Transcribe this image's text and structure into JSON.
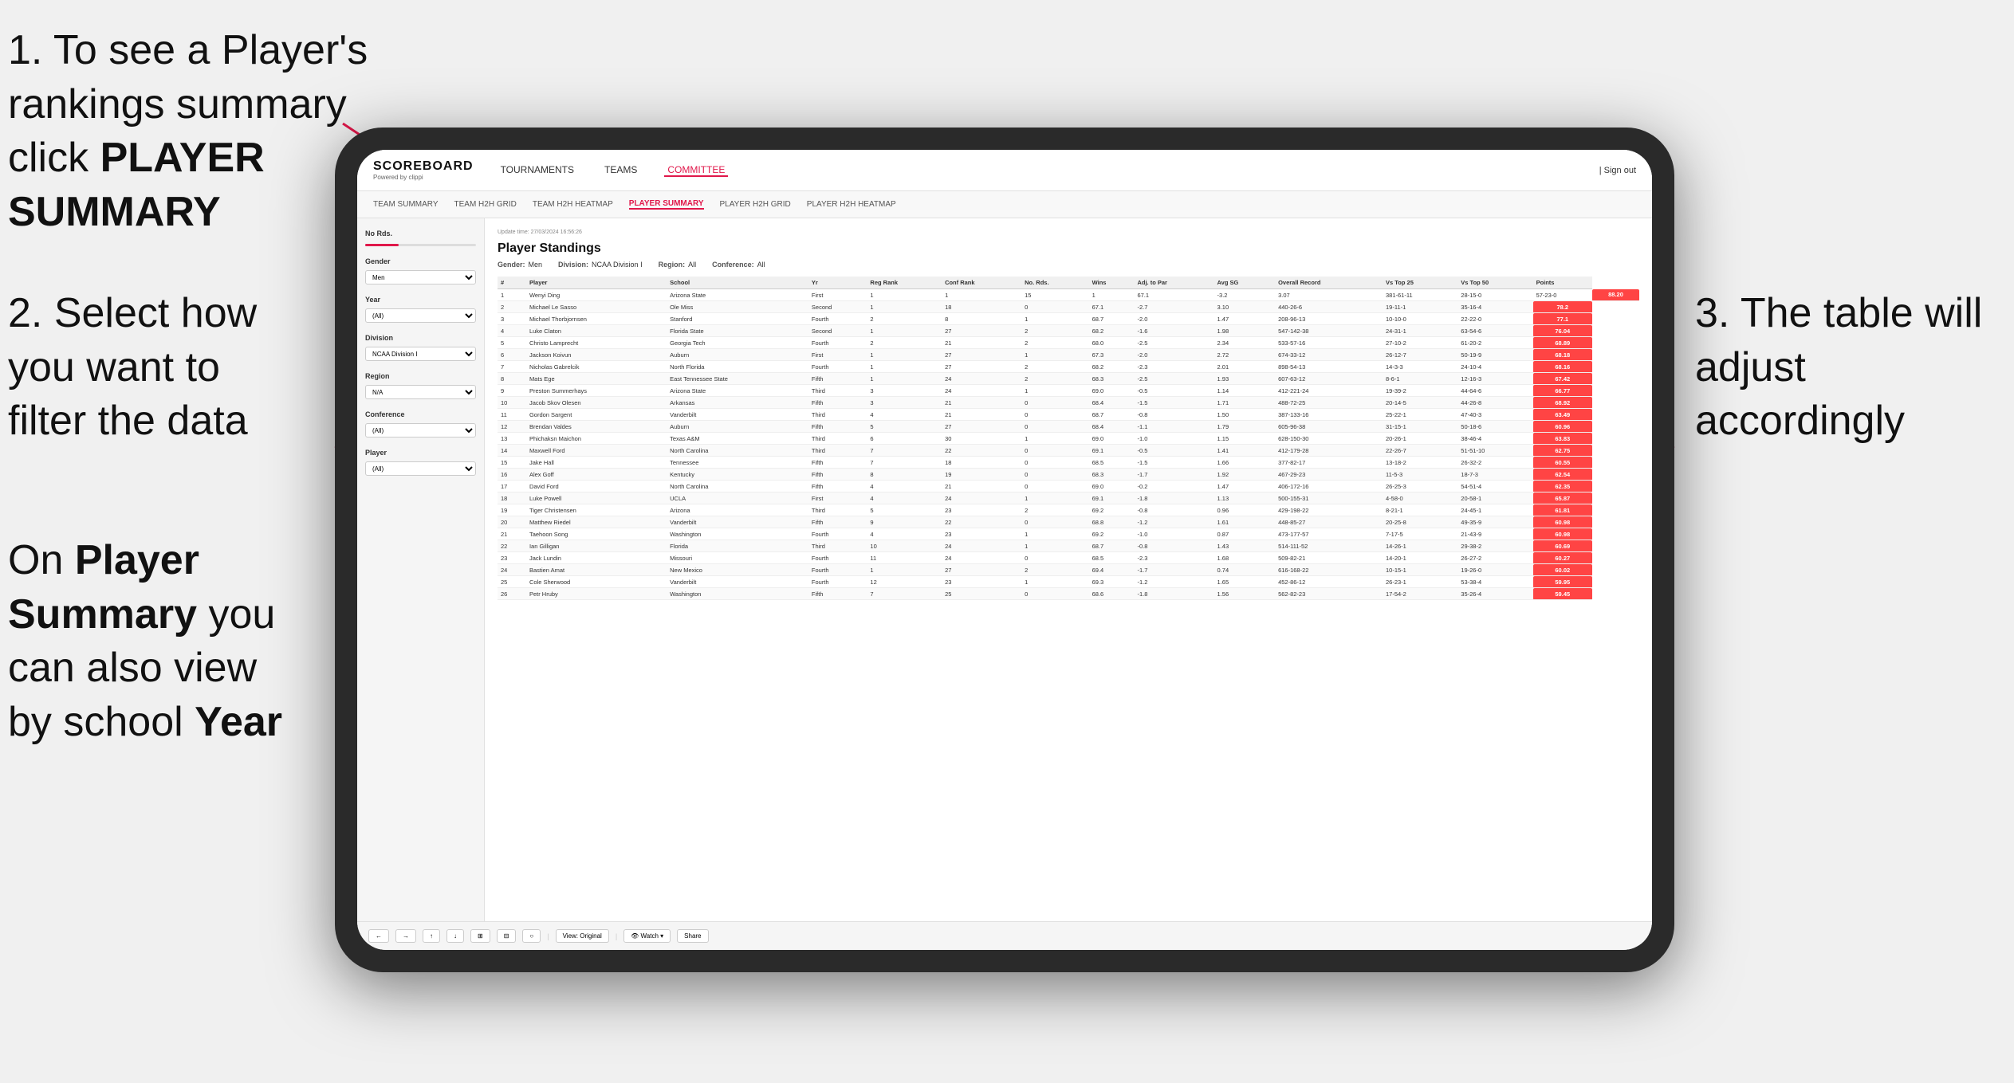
{
  "instructions": {
    "step1": "1. To see a Player's rankings summary click ",
    "step1_bold": "PLAYER SUMMARY",
    "step2_title": "2. Select how you want to filter the data",
    "step3_title": "3. The table will adjust accordingly",
    "bottom_note": "On ",
    "bottom_bold1": "Player Summary",
    "bottom_note2": " you can also view by school ",
    "bottom_bold2": "Year"
  },
  "navbar": {
    "logo": "SCOREBOARD",
    "logo_sub": "Powered by clippi",
    "links": [
      "TOURNAMENTS",
      "TEAMS",
      "COMMITTEE"
    ],
    "active_link": "COMMITTEE",
    "right_items": [
      "| Sign out"
    ]
  },
  "sub_navbar": {
    "links": [
      "TEAM SUMMARY",
      "TEAM H2H GRID",
      "TEAM H2H HEATMAP",
      "PLAYER SUMMARY",
      "PLAYER H2H GRID",
      "PLAYER H2H HEATMAP"
    ],
    "active": "PLAYER SUMMARY"
  },
  "sidebar": {
    "no_rds_label": "No Rds.",
    "gender_label": "Gender",
    "gender_value": "Men",
    "year_label": "Year",
    "year_value": "(All)",
    "division_label": "Division",
    "division_value": "NCAA Division I",
    "region_label": "Region",
    "region_value": "N/A",
    "conference_label": "Conference",
    "conference_value": "(All)",
    "player_label": "Player",
    "player_value": "(All)"
  },
  "table": {
    "title": "Player Standings",
    "update_time": "Update time: 27/03/2024 16:56:26",
    "filters": {
      "gender_label": "Gender:",
      "gender_value": "Men",
      "division_label": "Division:",
      "division_value": "NCAA Division I",
      "region_label": "Region:",
      "region_value": "All",
      "conference_label": "Conference:",
      "conference_value": "All"
    },
    "columns": [
      "#",
      "Player",
      "School",
      "Yr",
      "Reg Rank",
      "Conf Rank",
      "No. Rds.",
      "Wins",
      "Adj. to Par",
      "Avg SG",
      "Overall Record",
      "Vs Top 25",
      "Vs Top 50",
      "Points"
    ],
    "rows": [
      [
        "1",
        "Wenyi Ding",
        "Arizona State",
        "First",
        "1",
        "1",
        "15",
        "1",
        "67.1",
        "-3.2",
        "3.07",
        "381-61-11",
        "28-15-0",
        "57-23-0",
        "88.20"
      ],
      [
        "2",
        "Michael Le Sasso",
        "Ole Miss",
        "Second",
        "1",
        "18",
        "0",
        "67.1",
        "-2.7",
        "3.10",
        "440-26-6",
        "19-11-1",
        "35-16-4",
        "78.2"
      ],
      [
        "3",
        "Michael Thorbjornsen",
        "Stanford",
        "Fourth",
        "2",
        "8",
        "1",
        "68.7",
        "-2.0",
        "1.47",
        "208-96-13",
        "10-10-0",
        "22-22-0",
        "77.1"
      ],
      [
        "4",
        "Luke Claton",
        "Florida State",
        "Second",
        "1",
        "27",
        "2",
        "68.2",
        "-1.6",
        "1.98",
        "547-142-38",
        "24-31-1",
        "63-54-6",
        "76.04"
      ],
      [
        "5",
        "Christo Lamprecht",
        "Georgia Tech",
        "Fourth",
        "2",
        "21",
        "2",
        "68.0",
        "-2.5",
        "2.34",
        "533-57-16",
        "27-10-2",
        "61-20-2",
        "68.89"
      ],
      [
        "6",
        "Jackson Koivun",
        "Auburn",
        "First",
        "1",
        "27",
        "1",
        "67.3",
        "-2.0",
        "2.72",
        "674-33-12",
        "26-12-7",
        "50-19-9",
        "68.18"
      ],
      [
        "7",
        "Nicholas Gabrelcik",
        "North Florida",
        "Fourth",
        "1",
        "27",
        "2",
        "68.2",
        "-2.3",
        "2.01",
        "898-54-13",
        "14-3-3",
        "24-10-4",
        "68.16"
      ],
      [
        "8",
        "Mats Ege",
        "East Tennessee State",
        "Fifth",
        "1",
        "24",
        "2",
        "68.3",
        "-2.5",
        "1.93",
        "607-63-12",
        "8-6-1",
        "12-16-3",
        "67.42"
      ],
      [
        "9",
        "Preston Summerhays",
        "Arizona State",
        "Third",
        "3",
        "24",
        "1",
        "69.0",
        "-0.5",
        "1.14",
        "412-221-24",
        "19-39-2",
        "44-64-6",
        "66.77"
      ],
      [
        "10",
        "Jacob Skov Olesen",
        "Arkansas",
        "Fifth",
        "3",
        "21",
        "0",
        "68.4",
        "-1.5",
        "1.71",
        "488-72-25",
        "20-14-5",
        "44-26-8",
        "68.92"
      ],
      [
        "11",
        "Gordon Sargent",
        "Vanderbilt",
        "Third",
        "4",
        "21",
        "0",
        "68.7",
        "-0.8",
        "1.50",
        "387-133-16",
        "25-22-1",
        "47-40-3",
        "63.49"
      ],
      [
        "12",
        "Brendan Valdes",
        "Auburn",
        "Fifth",
        "5",
        "27",
        "0",
        "68.4",
        "-1.1",
        "1.79",
        "605-96-38",
        "31-15-1",
        "50-18-6",
        "60.96"
      ],
      [
        "13",
        "Phichaksn Maichon",
        "Texas A&M",
        "Third",
        "6",
        "30",
        "1",
        "69.0",
        "-1.0",
        "1.15",
        "628-150-30",
        "20-26-1",
        "38-46-4",
        "63.83"
      ],
      [
        "14",
        "Maxwell Ford",
        "North Carolina",
        "Third",
        "7",
        "22",
        "0",
        "69.1",
        "-0.5",
        "1.41",
        "412-179-28",
        "22-26-7",
        "51-51-10",
        "62.75"
      ],
      [
        "15",
        "Jake Hall",
        "Tennessee",
        "Fifth",
        "7",
        "18",
        "0",
        "68.5",
        "-1.5",
        "1.66",
        "377-82-17",
        "13-18-2",
        "26-32-2",
        "60.55"
      ],
      [
        "16",
        "Alex Goff",
        "Kentucky",
        "Fifth",
        "8",
        "19",
        "0",
        "68.3",
        "-1.7",
        "1.92",
        "467-29-23",
        "11-5-3",
        "18-7-3",
        "62.54"
      ],
      [
        "17",
        "David Ford",
        "North Carolina",
        "Fifth",
        "4",
        "21",
        "0",
        "69.0",
        "-0.2",
        "1.47",
        "406-172-16",
        "26-25-3",
        "54-51-4",
        "62.35"
      ],
      [
        "18",
        "Luke Powell",
        "UCLA",
        "First",
        "4",
        "24",
        "1",
        "69.1",
        "-1.8",
        "1.13",
        "500-155-31",
        "4-58-0",
        "20-58-1",
        "65.87"
      ],
      [
        "19",
        "Tiger Christensen",
        "Arizona",
        "Third",
        "5",
        "23",
        "2",
        "69.2",
        "-0.8",
        "0.96",
        "429-198-22",
        "8-21-1",
        "24-45-1",
        "61.81"
      ],
      [
        "20",
        "Matthew Riedel",
        "Vanderbilt",
        "Fifth",
        "9",
        "22",
        "0",
        "68.8",
        "-1.2",
        "1.61",
        "448-85-27",
        "20-25-8",
        "49-35-9",
        "60.98"
      ],
      [
        "21",
        "Taehoon Song",
        "Washington",
        "Fourth",
        "4",
        "23",
        "1",
        "69.2",
        "-1.0",
        "0.87",
        "473-177-57",
        "7-17-5",
        "21-43-9",
        "60.98"
      ],
      [
        "22",
        "Ian Gilligan",
        "Florida",
        "Third",
        "10",
        "24",
        "1",
        "68.7",
        "-0.8",
        "1.43",
        "514-111-52",
        "14-26-1",
        "29-38-2",
        "60.69"
      ],
      [
        "23",
        "Jack Lundin",
        "Missouri",
        "Fourth",
        "11",
        "24",
        "0",
        "68.5",
        "-2.3",
        "1.68",
        "509-82-21",
        "14-20-1",
        "26-27-2",
        "60.27"
      ],
      [
        "24",
        "Bastien Amat",
        "New Mexico",
        "Fourth",
        "1",
        "27",
        "2",
        "69.4",
        "-1.7",
        "0.74",
        "616-168-22",
        "10-15-1",
        "19-26-0",
        "60.02"
      ],
      [
        "25",
        "Cole Sherwood",
        "Vanderbilt",
        "Fourth",
        "12",
        "23",
        "1",
        "69.3",
        "-1.2",
        "1.65",
        "452-86-12",
        "26-23-1",
        "53-38-4",
        "59.95"
      ],
      [
        "26",
        "Petr Hruby",
        "Washington",
        "Fifth",
        "7",
        "25",
        "0",
        "68.6",
        "-1.8",
        "1.56",
        "562-82-23",
        "17-54-2",
        "35-26-4",
        "59.45"
      ]
    ]
  },
  "toolbar": {
    "buttons": [
      "←",
      "→",
      "↑",
      "↓",
      "⊞",
      "⊟",
      "○",
      "View: Original",
      "👁 Watch ▾",
      "⬡",
      "⬡",
      "Share"
    ]
  }
}
